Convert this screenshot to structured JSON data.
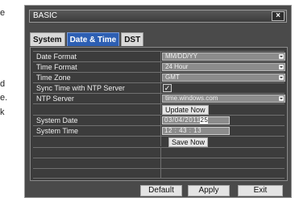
{
  "background_fragments": [
    "e",
    "d",
    "e.",
    "k"
  ],
  "window": {
    "title": "BASIC",
    "close_glyph": "×"
  },
  "tabs": [
    {
      "label": "System",
      "active": false
    },
    {
      "label": "Date & Time",
      "active": true
    },
    {
      "label": "DST",
      "active": false
    }
  ],
  "settings": {
    "date_format": {
      "label": "Date Format",
      "value": "MM/DD/YY"
    },
    "time_format": {
      "label": "Time Format",
      "value": "24 Hour"
    },
    "time_zone": {
      "label": "Time Zone",
      "value": "GMT"
    },
    "sync_ntp": {
      "label": "Sync Time with NTP Server",
      "checked": true,
      "glyph": "✓"
    },
    "ntp_server": {
      "label": "NTP Server",
      "value": "time.windows.com"
    },
    "update_now": {
      "label": "Update Now"
    },
    "system_date": {
      "label": "System Date",
      "value_main": "03/04/2011",
      "value_highlight": "25"
    },
    "system_time": {
      "label": "System Time",
      "value": "12 : 43 : 13"
    },
    "save_now": {
      "label": "Save Now"
    }
  },
  "footer": {
    "default_label": "Default",
    "apply_label": "Apply",
    "exit_label": "Exit"
  }
}
